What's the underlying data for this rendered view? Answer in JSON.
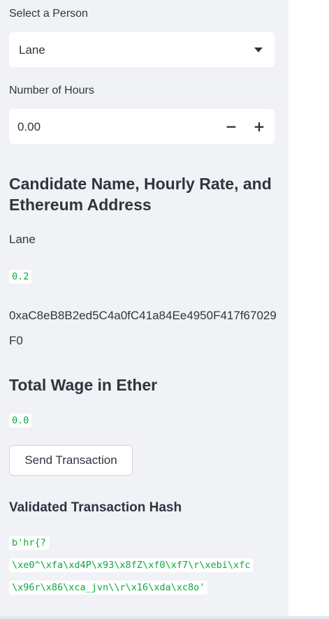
{
  "sidebar": {
    "select_person": {
      "label": "Select a Person",
      "value": "Lane"
    },
    "hours": {
      "label": "Number of Hours",
      "value": "0.00",
      "minus": "−",
      "plus": "+"
    },
    "candidate_heading": "Candidate Name, Hourly Rate, and Ethereum Address",
    "candidate_name": "Lane",
    "hourly_rate": "0.2",
    "eth_address": "0xaC8eB8B2ed5C4a0fC41a84Ee4950F417f67029F0",
    "wage_heading": "Total Wage in Ether",
    "total_wage": "0.0",
    "send_button": "Send Transaction",
    "hash_heading": "Validated Transaction Hash",
    "hash_lines": [
      "b'hr{?",
      "\\xe0^\\xfa\\xd4P\\x93\\x8fZ\\xf0\\xf7\\r\\xebi\\xfc",
      "\\x96r\\x86\\xca_jvn\\\\r\\x16\\xda\\xc8o'"
    ]
  }
}
